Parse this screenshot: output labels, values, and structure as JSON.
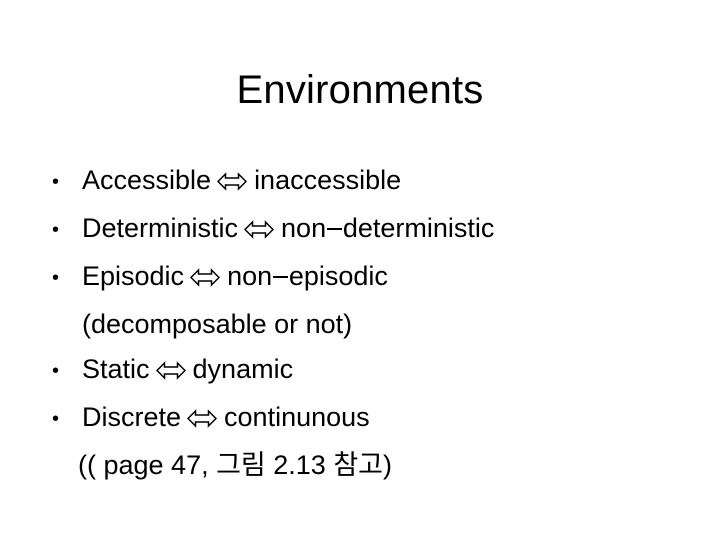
{
  "slide": {
    "title": "Environments",
    "background_color": "#ffffff",
    "text_color": "#000000",
    "arrow_symbol": "left-right-double-arrow",
    "lines": [
      {
        "bullet": "•",
        "left": "Accessible",
        "arrow": true,
        "right": "inaccessible"
      },
      {
        "bullet": "•",
        "left": "Deterministic",
        "arrow": true,
        "right_pre": "non",
        "right_post": "deterministic"
      },
      {
        "bullet": "•",
        "left": "Episodic",
        "arrow": true,
        "right_pre": "non",
        "right_post": "episodic"
      },
      {
        "bullet": "",
        "note": "(decomposable or not)"
      },
      {
        "bullet": "•",
        "left": "Static",
        "arrow": true,
        "right": "dynamic"
      },
      {
        "bullet": "•",
        "left": "Discrete",
        "arrow": true,
        "right": "continunous"
      },
      {
        "bullet": "",
        "note": "(( page 47, 그림 2.13 참고)"
      }
    ]
  }
}
